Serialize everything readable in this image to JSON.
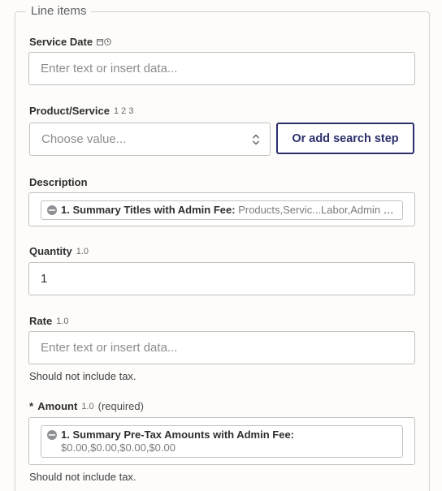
{
  "section": {
    "legend": "Line items"
  },
  "service_date": {
    "label": "Service Date",
    "icons": [
      "calendar-icon",
      "clock-icon"
    ],
    "placeholder": "Enter text or insert data..."
  },
  "product_service": {
    "label": "Product/Service",
    "type_hint": "1 2 3",
    "placeholder": "Choose value...",
    "search_button": "Or add search step"
  },
  "description": {
    "label": "Description",
    "pill_title": "1. Summary Titles with Admin Fee:",
    "pill_value": "Products,Servic...Labor,Admin Fee"
  },
  "quantity": {
    "label": "Quantity",
    "type_hint": "1.0",
    "value": "1"
  },
  "rate": {
    "label": "Rate",
    "type_hint": "1.0",
    "placeholder": "Enter text or insert data...",
    "help": "Should not include tax."
  },
  "amount": {
    "required_marker": "*",
    "label": "Amount",
    "type_hint": "1.0",
    "required_text": "(required)",
    "pill_title": "1. Summary Pre-Tax Amounts with Admin Fee:",
    "pill_value": "$0.00,$0.00,$0.00,$0.00",
    "help": "Should not include tax."
  }
}
